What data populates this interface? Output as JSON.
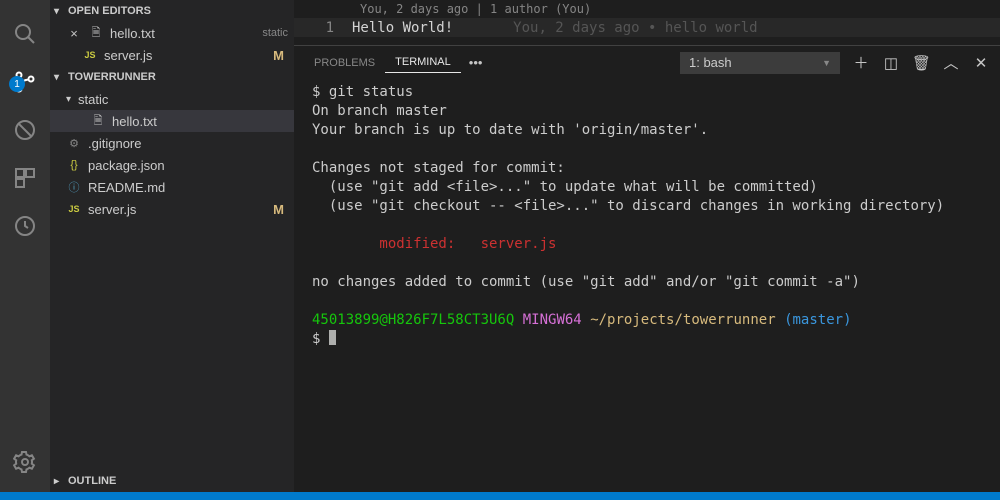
{
  "activity": {
    "badge": "1"
  },
  "sidebar": {
    "openEditors": {
      "title": "OPEN EDITORS",
      "items": [
        {
          "name": "hello.txt",
          "meta": "static",
          "icon": "file",
          "close": true
        },
        {
          "name": "server.js",
          "meta": "",
          "icon": "js",
          "status": "M"
        }
      ]
    },
    "workspace": {
      "title": "TOWERRUNNER",
      "items": [
        {
          "name": "static",
          "type": "folder",
          "depth": 1,
          "expanded": true
        },
        {
          "name": "hello.txt",
          "type": "file",
          "icon": "file",
          "depth": 2,
          "selected": true
        },
        {
          "name": ".gitignore",
          "type": "file",
          "icon": "gear",
          "depth": 1
        },
        {
          "name": "package.json",
          "type": "file",
          "icon": "braces",
          "depth": 1
        },
        {
          "name": "README.md",
          "type": "file",
          "icon": "info",
          "depth": 1
        },
        {
          "name": "server.js",
          "type": "file",
          "icon": "js",
          "depth": 1,
          "status": "M"
        }
      ]
    },
    "outline": {
      "title": "OUTLINE"
    }
  },
  "editor": {
    "codelens": "You, 2 days ago | 1 author (You)",
    "line1_num": "1",
    "line1_text": "Hello World!",
    "line1_blame": "You, 2 days ago • hello world"
  },
  "panel": {
    "tabs": {
      "problems": "Problems",
      "terminal": "Terminal"
    },
    "more": "•••",
    "select": "1: bash",
    "terminal": {
      "l1": "$ git status",
      "l2": "On branch master",
      "l3": "Your branch is up to date with 'origin/master'.",
      "l4": "Changes not staged for commit:",
      "l5": "  (use \"git add <file>...\" to update what will be committed)",
      "l6": "  (use \"git checkout -- <file>...\" to discard changes in working directory)",
      "l7": "        modified:   server.js",
      "l8": "no changes added to commit (use \"git add\" and/or \"git commit -a\")",
      "p_user": "45013899@H826F7L58CT3U6Q",
      "p_env": "MINGW64",
      "p_path": "~/projects/towerrunner",
      "p_branch": "(master)",
      "prompt": "$ "
    }
  }
}
